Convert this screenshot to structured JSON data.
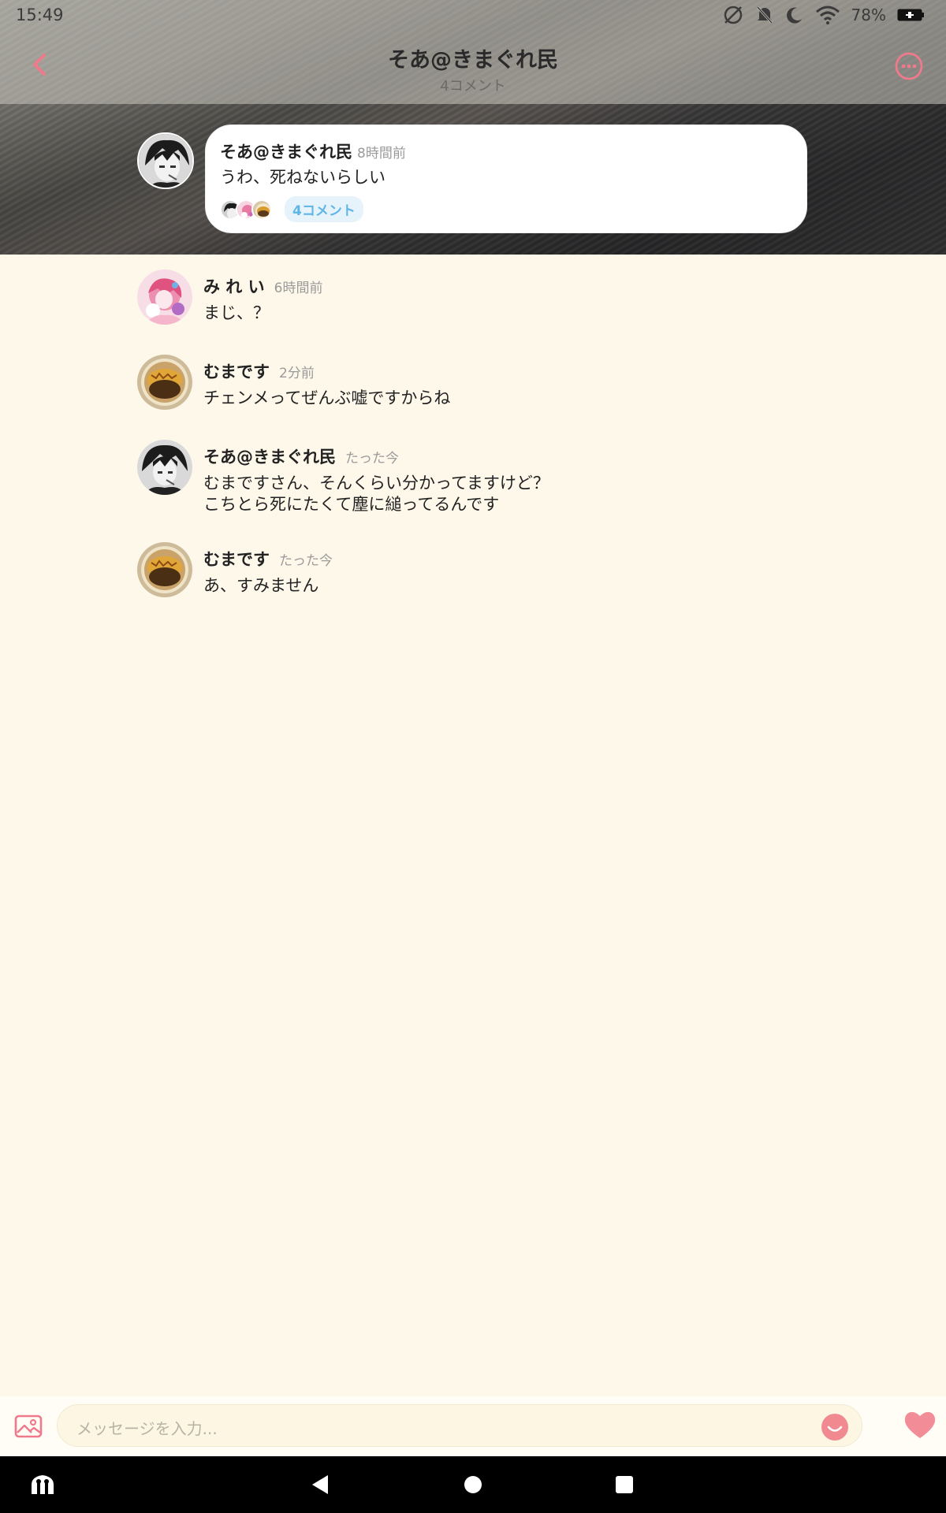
{
  "status_bar": {
    "time": "15:49",
    "battery_percent": "78%",
    "icons": [
      "no-sync-icon",
      "mute-icon",
      "moon-icon",
      "wifi-icon",
      "battery-icon"
    ]
  },
  "header": {
    "title": "そあ@きまぐれ民",
    "subtitle": "4コメント"
  },
  "post": {
    "author": "そあ@きまぐれ民",
    "time": "8時間前",
    "text": "うわ、死ねないらしい",
    "comment_pill": "4コメント"
  },
  "comments": [
    {
      "author": "み れ い",
      "time": "6時間前",
      "text": "まじ、？"
    },
    {
      "author": "むまです",
      "time": "2分前",
      "text": "チェンメってぜんぶ嘘ですからね"
    },
    {
      "author": "そあ@きまぐれ民",
      "time": "たった今",
      "text_line1": "むまですさん、そんくらい分かってますけど？",
      "text_line2": "こちとら死にたくて塵に縋ってるんです"
    },
    {
      "author": "むまです",
      "time": "たった今",
      "text": "あ、すみません"
    }
  ],
  "input": {
    "placeholder": "メッセージを入力..."
  },
  "colors": {
    "accent": "#f07a8c",
    "background": "#fdf8ea",
    "pill_text": "#5eb6e6"
  }
}
